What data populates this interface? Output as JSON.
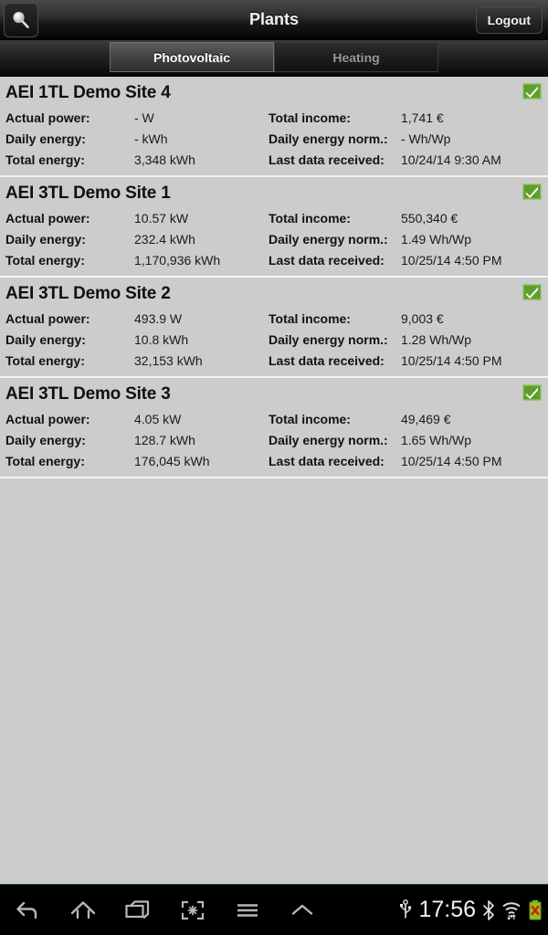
{
  "header": {
    "title": "Plants",
    "search_icon": "search-icon",
    "logout_label": "Logout"
  },
  "tabs": [
    {
      "label": "Photovoltaic",
      "selected": true
    },
    {
      "label": "Heating",
      "selected": false
    }
  ],
  "field_labels": {
    "actual_power": "Actual power:",
    "daily_energy": "Daily energy:",
    "total_energy": "Total energy:",
    "total_income": "Total income:",
    "daily_energy_norm": "Daily energy norm.:",
    "last_data_received": "Last data received:"
  },
  "plants": [
    {
      "name": "AEI 1TL Demo Site 4",
      "status": "ok",
      "actual_power": "- W",
      "daily_energy": "- kWh",
      "total_energy": "3,348 kWh",
      "total_income": "1,741 €",
      "daily_energy_norm": "- Wh/Wp",
      "last_data_received": "10/24/14 9:30 AM"
    },
    {
      "name": "AEI 3TL Demo Site 1",
      "status": "ok",
      "actual_power": "10.57 kW",
      "daily_energy": "232.4 kWh",
      "total_energy": "1,170,936 kWh",
      "total_income": "550,340 €",
      "daily_energy_norm": "1.49 Wh/Wp",
      "last_data_received": "10/25/14 4:50 PM"
    },
    {
      "name": "AEI 3TL Demo Site 2",
      "status": "ok",
      "actual_power": "493.9 W",
      "daily_energy": "10.8 kWh",
      "total_energy": "32,153 kWh",
      "total_income": "9,003 €",
      "daily_energy_norm": "1.28 Wh/Wp",
      "last_data_received": "10/25/14 4:50 PM"
    },
    {
      "name": "AEI 3TL Demo Site 3",
      "status": "ok",
      "actual_power": "4.05 kW",
      "daily_energy": "128.7 kWh",
      "total_energy": "176,045 kWh",
      "total_income": "49,469 €",
      "daily_energy_norm": "1.65 Wh/Wp",
      "last_data_received": "10/25/14 4:50 PM"
    }
  ],
  "navbar": {
    "icons": [
      "back-icon",
      "home-icon",
      "recents-icon",
      "screenshot-icon",
      "menu-icon",
      "chevron-up-icon"
    ],
    "clock": "17:56",
    "status_icons": [
      "usb-icon",
      "bluetooth-icon",
      "wifi-icon",
      "battery-error-icon"
    ]
  },
  "colors": {
    "accent_green": "#6aa832",
    "list_background": "#cccccc",
    "divider": "#f4f4f4",
    "battery_green": "#8fc31f",
    "battery_error_red": "#d81e06"
  }
}
